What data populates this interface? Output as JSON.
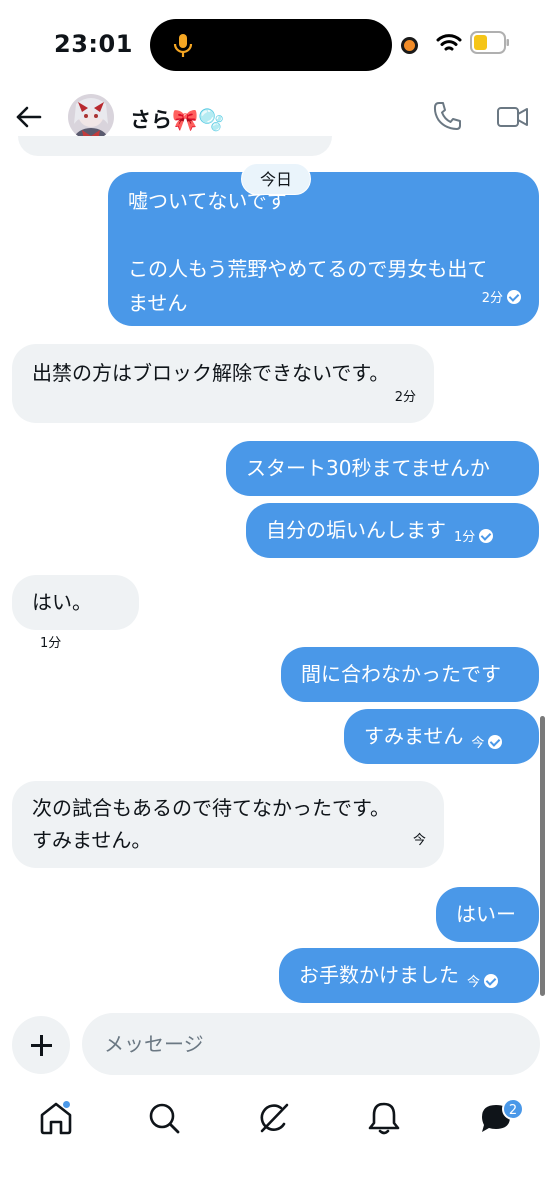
{
  "status_bar": {
    "time": "23:01"
  },
  "header": {
    "contact_name": "さら",
    "contact_emoji": "🎀🫧"
  },
  "date_chip": "今日",
  "messages": [
    {
      "side": "out",
      "lines": [
        "嘘ついてないです",
        "",
        "この人もう荒野やめてるので男女も出て",
        "ません"
      ],
      "time": "2分",
      "read": true
    },
    {
      "side": "in",
      "text": "出禁の方はブロック解除できないです。",
      "time": "2分"
    },
    {
      "side": "out",
      "text": "スタート30秒まてませんか"
    },
    {
      "side": "out",
      "text": "自分の垢いんします",
      "time": "1分",
      "read": true
    },
    {
      "side": "in",
      "text": "はい。",
      "time": "1分"
    },
    {
      "side": "out",
      "text": "間に合わなかったです"
    },
    {
      "side": "out",
      "text": "すみません",
      "time": "今",
      "read": true
    },
    {
      "side": "in",
      "lines": [
        "次の試合もあるので待てなかったです。",
        "すみません。"
      ],
      "time": "今"
    },
    {
      "side": "out",
      "text": "はいー"
    },
    {
      "side": "out",
      "text": "お手数かけました",
      "time": "今",
      "read": true
    }
  ],
  "composer": {
    "placeholder": "メッセージ"
  },
  "tab_bar": {
    "messages_badge": "2"
  },
  "colors": {
    "outgoing_bubble": "#4a98e8",
    "incoming_bubble": "#eff2f4",
    "accent": "#4a98e8"
  }
}
